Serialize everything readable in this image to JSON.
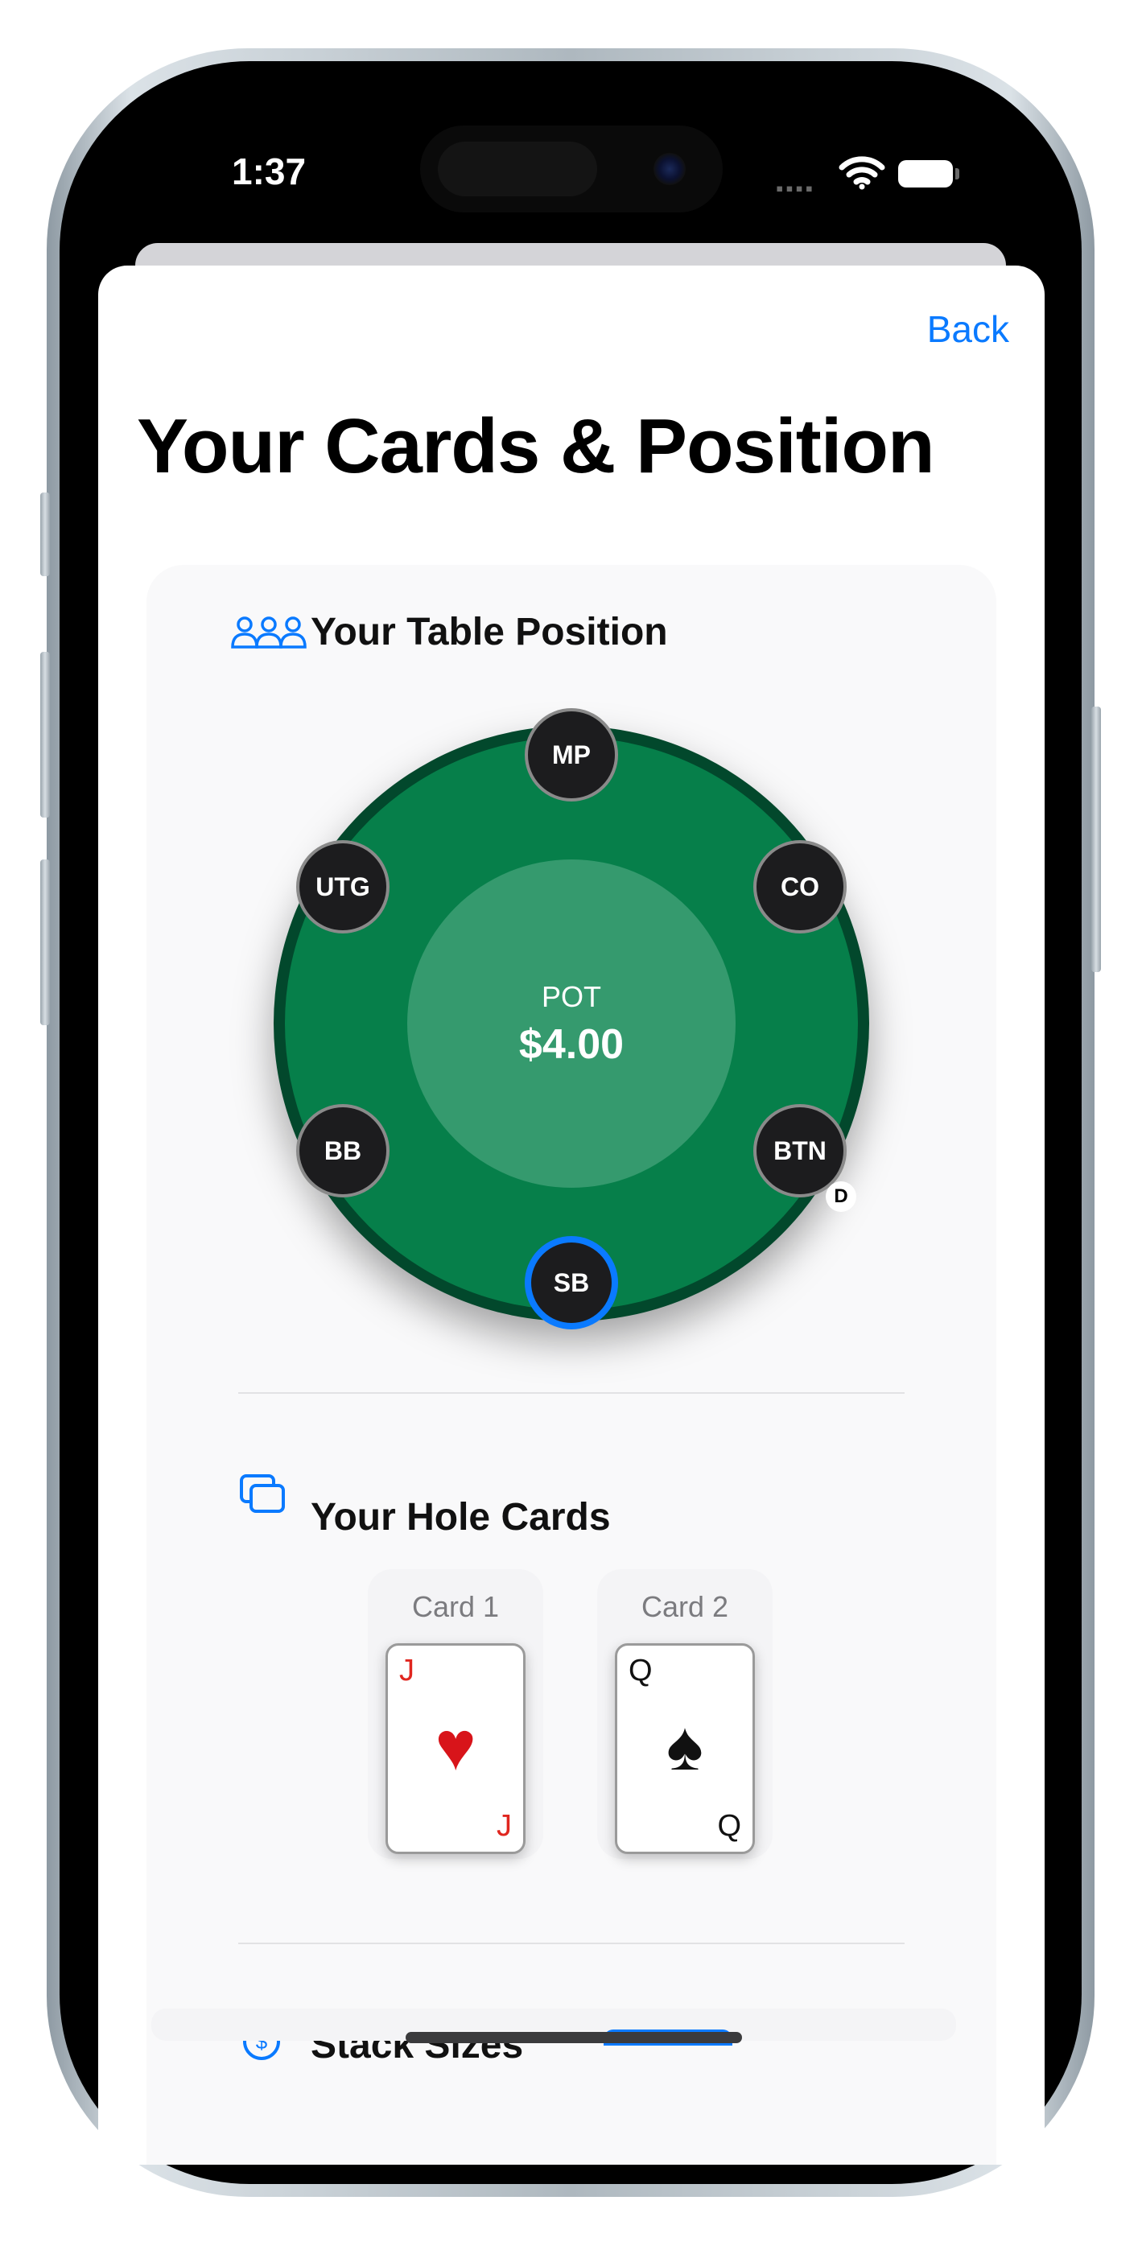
{
  "status_bar": {
    "time": "1:37",
    "signal_icon": "signal-icon",
    "wifi_icon": "wifi-icon",
    "battery_icon": "battery-icon"
  },
  "nav": {
    "back_label": "Back"
  },
  "page": {
    "title": "Your Cards & Position"
  },
  "position_section": {
    "icon": "people-icon",
    "title": "Your Table Position",
    "pot_label": "POT",
    "pot_value": "$4.00",
    "seats": {
      "mp": "MP",
      "co": "CO",
      "btn": "BTN",
      "sb": "SB",
      "bb": "BB",
      "utg": "UTG"
    },
    "selected_seat": "SB",
    "dealer_seat": "BTN",
    "dealer_marker": "D"
  },
  "hole_cards_section": {
    "icon": "cards-icon",
    "title": "Your Hole Cards",
    "cards": [
      {
        "label": "Card 1",
        "rank": "J",
        "suit": "♥",
        "color": "#e0261f"
      },
      {
        "label": "Card 2",
        "rank": "Q",
        "suit": "♠",
        "color": "#111111"
      }
    ]
  },
  "stack_section": {
    "icon": "dollar-circle-icon",
    "title": "Stack Sizes"
  },
  "colors": {
    "accent": "#0a7aff",
    "felt": "#067f4a",
    "rim": "#02482c"
  }
}
